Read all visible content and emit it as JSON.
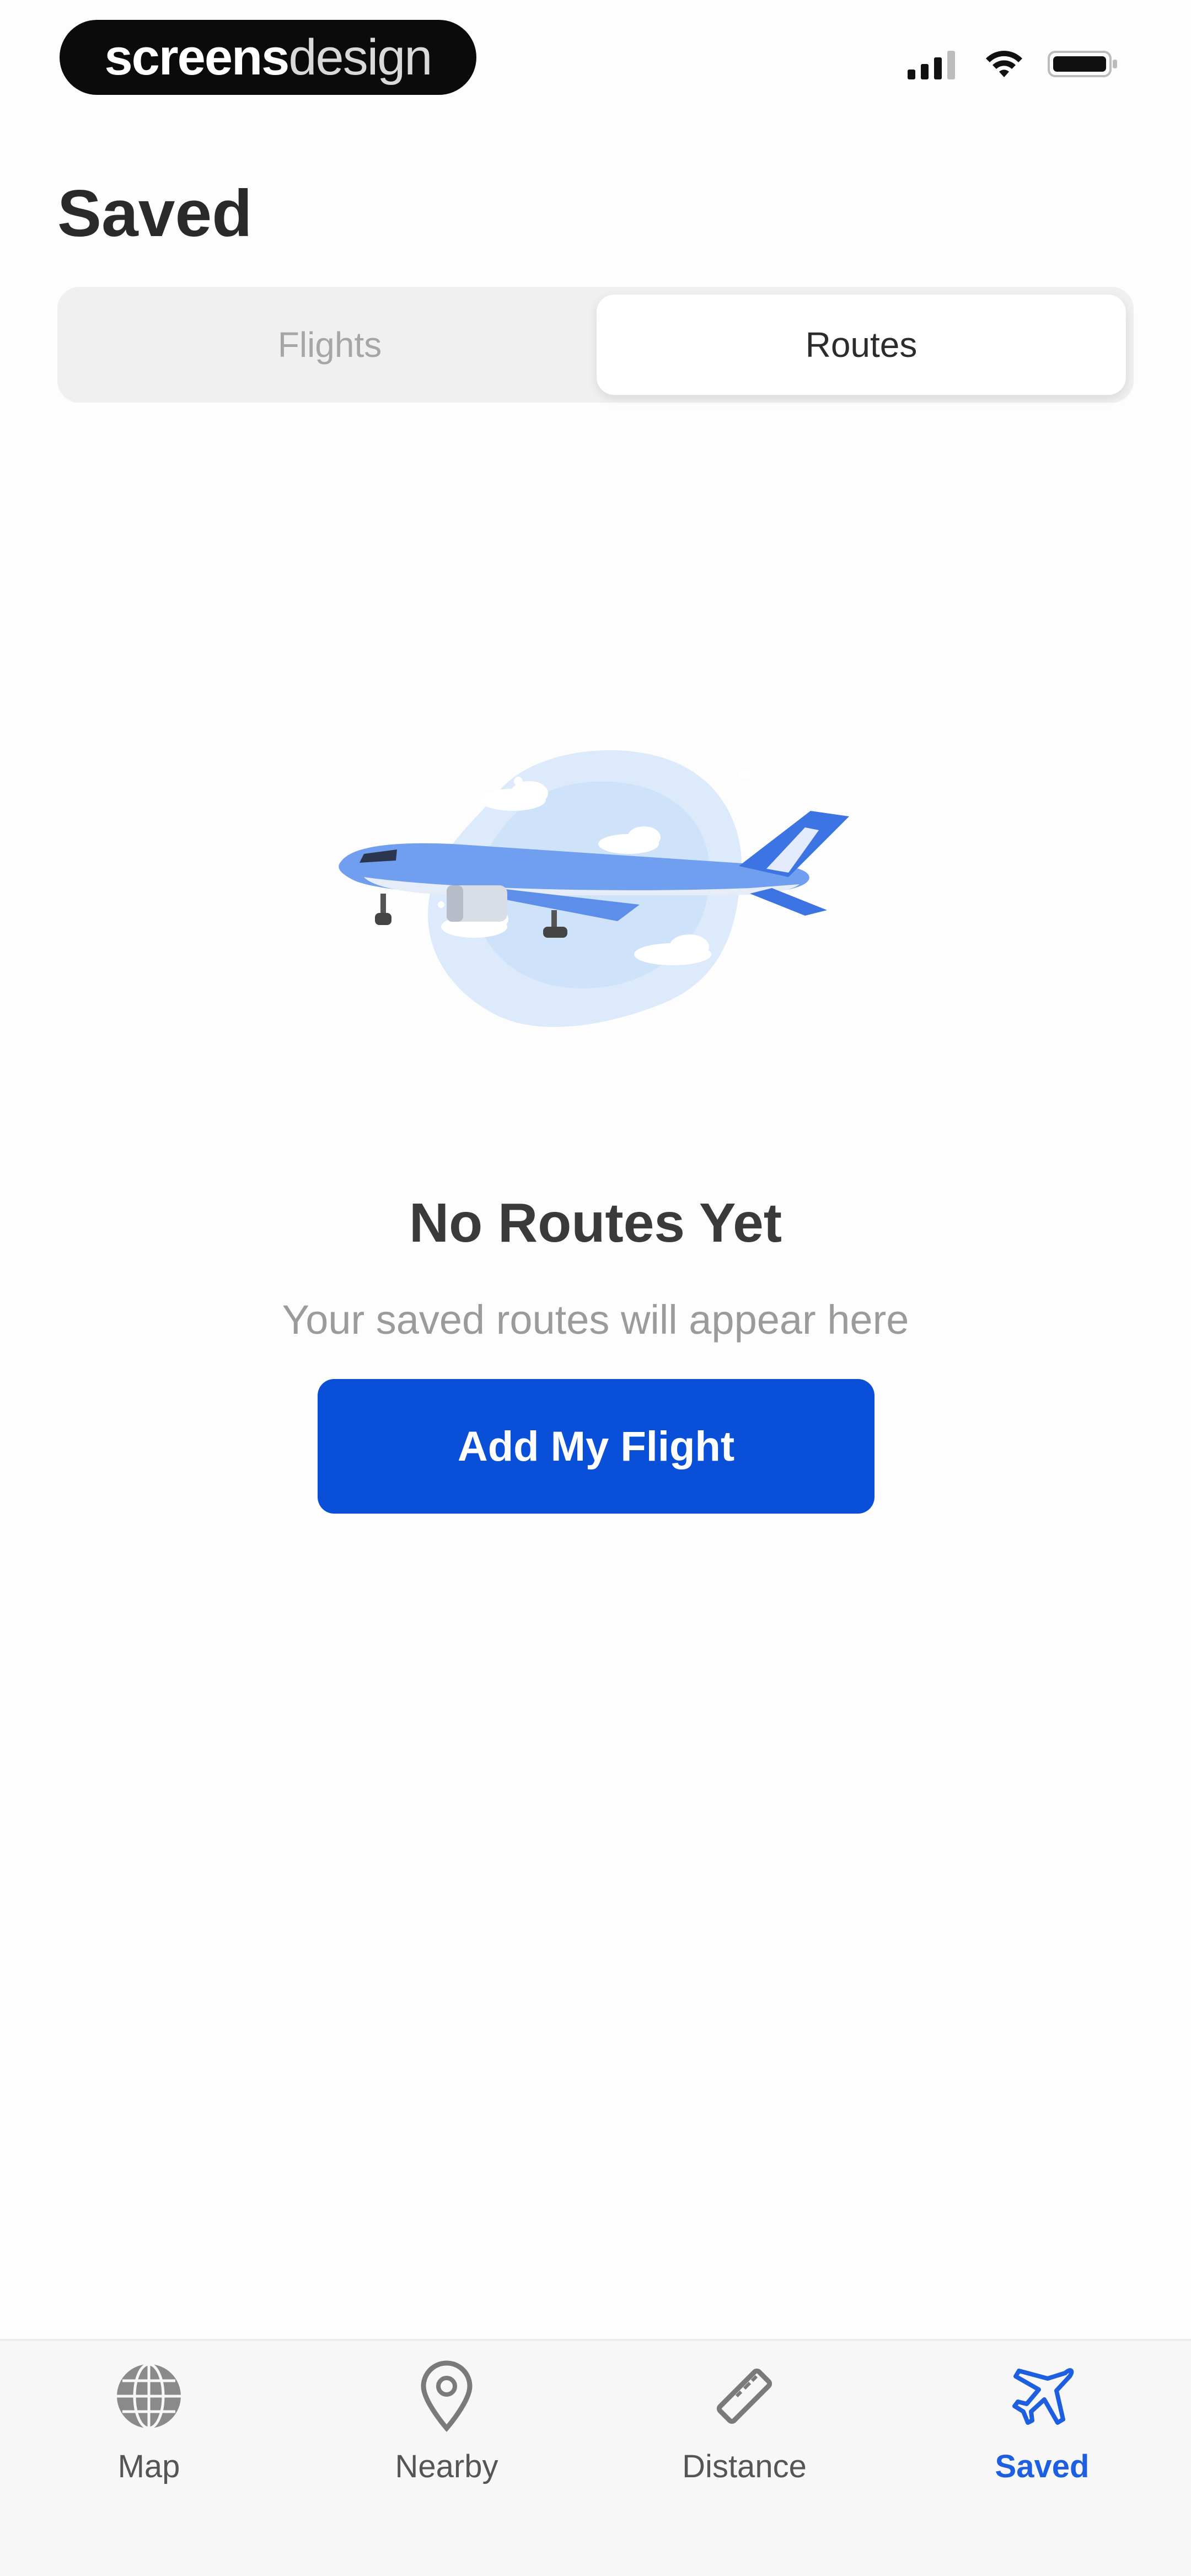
{
  "status_bar": {
    "brand_bold": "screens",
    "brand_light": "design"
  },
  "header": {
    "title": "Saved"
  },
  "segments": {
    "flights": "Flights",
    "routes": "Routes",
    "selected": "Routes"
  },
  "empty_state": {
    "title": "No Routes Yet",
    "subtitle": "Your saved routes will appear here",
    "button": "Add My Flight"
  },
  "tab_bar": {
    "items": [
      {
        "label": "Map",
        "icon": "globe-icon"
      },
      {
        "label": "Nearby",
        "icon": "location-pin-icon"
      },
      {
        "label": "Distance",
        "icon": "ruler-icon"
      },
      {
        "label": "Saved",
        "icon": "airplane-icon"
      }
    ],
    "active": "Saved"
  },
  "colors": {
    "accent": "#0a4fd8",
    "active_tab": "#1d5fe0",
    "title": "#2a2a2a",
    "muted": "#9b9b9b"
  }
}
